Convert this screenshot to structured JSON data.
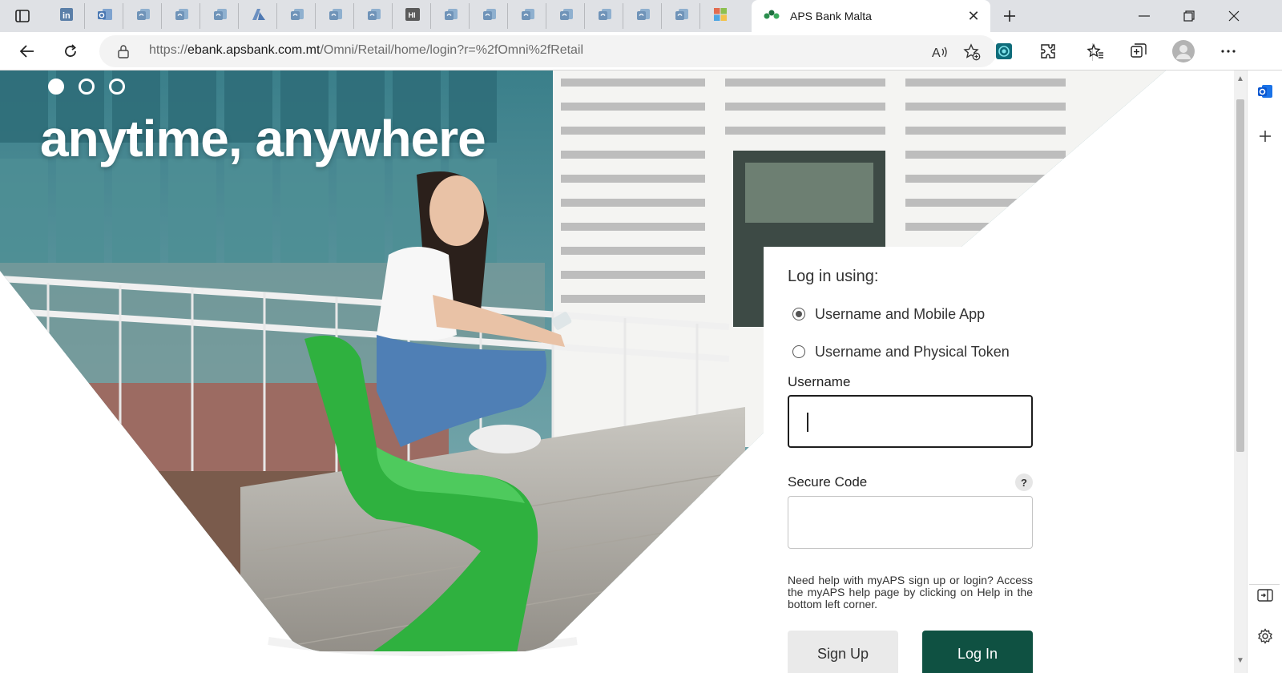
{
  "browser": {
    "pinned_tabs": [
      {
        "icon": "linkedin-icon"
      },
      {
        "icon": "outlook-icon"
      },
      {
        "icon": "edge-collections-icon"
      },
      {
        "icon": "edge-collections-icon"
      },
      {
        "icon": "edge-collections-icon"
      },
      {
        "icon": "azure-icon"
      },
      {
        "icon": "edge-collections-icon"
      },
      {
        "icon": "edge-collections-icon"
      },
      {
        "icon": "edge-collections-icon"
      },
      {
        "icon": "hp-app-icon"
      },
      {
        "icon": "edge-collections-icon"
      },
      {
        "icon": "edge-collections-icon"
      },
      {
        "icon": "edge-collections-icon"
      },
      {
        "icon": "edge-collections-icon"
      },
      {
        "icon": "edge-collections-icon"
      },
      {
        "icon": "edge-collections-icon"
      },
      {
        "icon": "edge-collections-icon"
      },
      {
        "icon": "microsoft-icon"
      }
    ],
    "active_tab": {
      "title": "APS Bank Malta",
      "favicon": "aps-bank-logo-icon"
    },
    "address": {
      "scheme": "https://",
      "host": "ebank.apsbank.com.mt",
      "path": "/Omni/Retail/home/login?r=%2fOmni%2fRetail"
    }
  },
  "hero": {
    "headline": "anytime, anywhere",
    "slides": 3,
    "active_slide": 1
  },
  "login": {
    "heading": "Log in using:",
    "options": [
      {
        "label": "Username and Mobile App",
        "checked": true
      },
      {
        "label": "Username and Physical Token",
        "checked": false
      }
    ],
    "username_label": "Username",
    "username_value": "",
    "secure_code_label": "Secure Code",
    "secure_code_help": "?",
    "secure_code_value": "",
    "help_text": "Need help with myAPS sign up or login? Access the myAPS help page by clicking on Help in the bottom left corner.",
    "signup_label": "Sign Up",
    "login_label": "Log In"
  },
  "colors": {
    "brand_green": "#0f5142",
    "chair_green": "#2fb13f"
  }
}
